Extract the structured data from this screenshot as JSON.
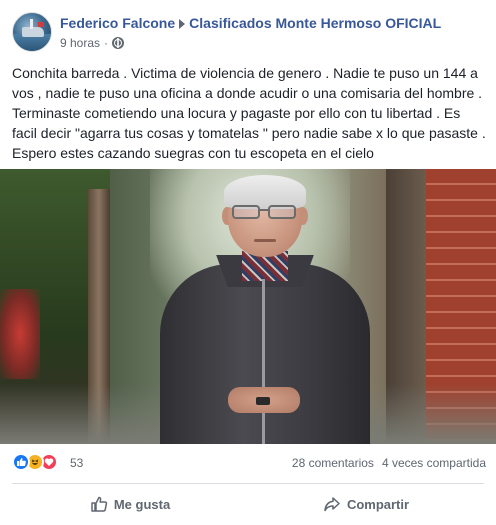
{
  "post": {
    "author": "Federico Falcone",
    "group": "Clasificados Monte Hermoso OFICIAL",
    "time": "9 horas",
    "separator": "·",
    "privacy_icon": "globe-icon",
    "text": "Conchita barreda . Victima de violencia de genero . Nadie te puso un 144 a vos , nadie te puso una oficina a donde acudir o una comisaria del hombre . Terminaste cometiendo una locura y pagaste por ello con tu libertad . Es facil decir \"agarra tus cosas y tomatelas \" pero nadie sabe x lo que pasaste . Espero estes cazando suegras con tu escopeta en el cielo"
  },
  "reactions": {
    "icons": [
      "like-icon",
      "haha-icon",
      "love-icon"
    ],
    "count": "53",
    "comments": "28 comentarios",
    "shares": "4 veces compartida"
  },
  "actions": {
    "like_label": "Me gusta",
    "share_label": "Compartir"
  },
  "colors": {
    "link": "#385898",
    "secondary_text": "#606770",
    "like_blue": "#1877f2",
    "love_red": "#f33e58",
    "haha_yellow": "#f7b125"
  }
}
